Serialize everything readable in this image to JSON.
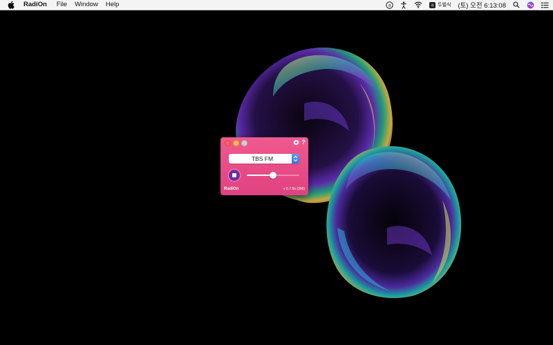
{
  "menubar": {
    "apple_icon": "apple-logo-icon",
    "app_name": "RadiOn",
    "menus": [
      "File",
      "Window",
      "Help"
    ],
    "tray": {
      "input_source_icon": "a-circle-icon",
      "accessibility_icon": "accessibility-icon",
      "wifi_icon": "wifi-icon",
      "ime_label": "두벌식",
      "clock": "(토) 오전 6:13:08",
      "search_icon": "spotlight-search-icon",
      "siri_icon": "siri-icon",
      "notification_icon": "notification-center-icon"
    }
  },
  "window": {
    "title_buttons": [
      "close",
      "minimize",
      "zoom"
    ],
    "settings_icon": "gear-icon",
    "help_label": "?",
    "station": {
      "selected": "TBS FM"
    },
    "playback": {
      "state": "playing",
      "button_icon": "stop-icon"
    },
    "volume": {
      "level": 0.5
    },
    "footer": {
      "app_name": "RadiOn",
      "version": "v 0.7.5b (306)"
    },
    "colors": {
      "background": "#e84c86",
      "stop_button": "#6a2fa6",
      "select_arrows": "#2f78e8"
    }
  },
  "wallpaper": {
    "description_icon": "iridescent-bubbles-wallpaper"
  }
}
